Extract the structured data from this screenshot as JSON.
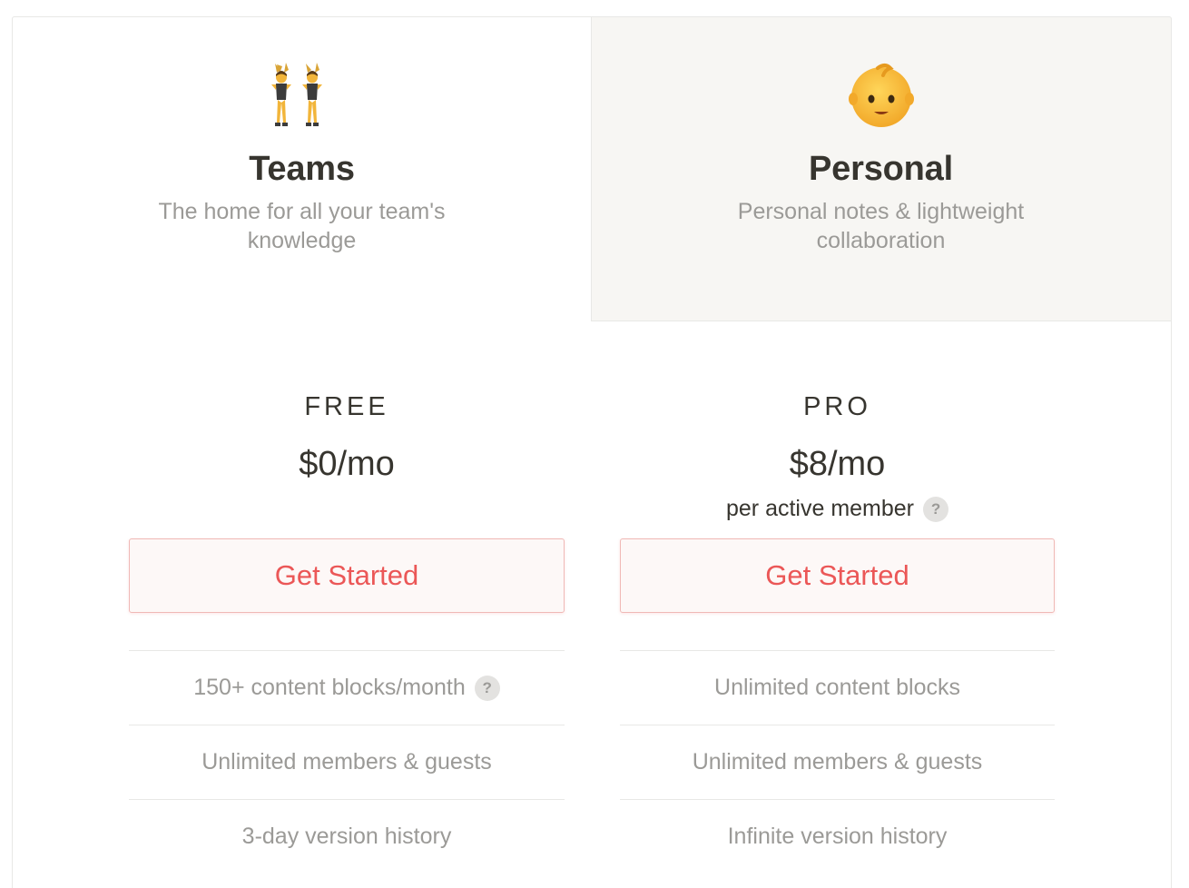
{
  "tabs": {
    "teams": {
      "title": "Teams",
      "subtitle": "The home for all your team's knowledge",
      "icon": "women-with-bunny-ears-icon"
    },
    "personal": {
      "title": "Personal",
      "subtitle": "Personal notes & lightweight collaboration",
      "icon": "baby-face-icon"
    }
  },
  "plans": {
    "free": {
      "name": "FREE",
      "price": "$0/mo",
      "cta_label": "Get Started",
      "features": [
        {
          "label": "150+ content blocks/month",
          "help": "?"
        },
        {
          "label": "Unlimited members & guests"
        },
        {
          "label": "3-day version history"
        }
      ]
    },
    "pro": {
      "name": "PRO",
      "price": "$8/mo",
      "note": "per active member",
      "note_help": "?",
      "cta_label": "Get Started",
      "features": [
        {
          "label": "Unlimited content blocks"
        },
        {
          "label": "Unlimited members & guests"
        },
        {
          "label": "Infinite version history"
        }
      ]
    }
  },
  "colors": {
    "accent_red": "#eb5757",
    "text_dark": "#37352f",
    "text_muted": "#9b9a97",
    "tab_inactive_bg": "#f7f6f3",
    "border": "#e8e8e6"
  }
}
